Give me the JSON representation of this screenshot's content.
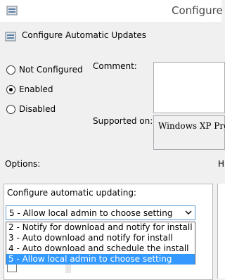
{
  "window": {
    "title": "Configure A",
    "icon": "policy-settings-icon"
  },
  "header": {
    "title": "Configure Automatic Updates",
    "icon": "policy-settings-icon"
  },
  "state": {
    "options": [
      {
        "label": "Not Configured",
        "selected": false
      },
      {
        "label": "Enabled",
        "selected": true
      },
      {
        "label": "Disabled",
        "selected": false
      }
    ]
  },
  "comment": {
    "label": "Comment:",
    "value": ""
  },
  "supported": {
    "label": "Supported on:",
    "value": "Windows XP Prof"
  },
  "options": {
    "label": "Options:",
    "help_label": "H"
  },
  "configure": {
    "caption": "Configure automatic updating:",
    "selected": "5 - Allow local admin to choose setting",
    "dropdown_items": [
      "2 - Notify for download and notify for install",
      "3 - Auto download and notify for install",
      "4 - Auto download and schedule the install",
      "5 - Allow local admin to choose setting"
    ],
    "selected_index": 3
  },
  "colors": {
    "selection": "#3399ff",
    "focus_border": "#5b9bd5"
  }
}
